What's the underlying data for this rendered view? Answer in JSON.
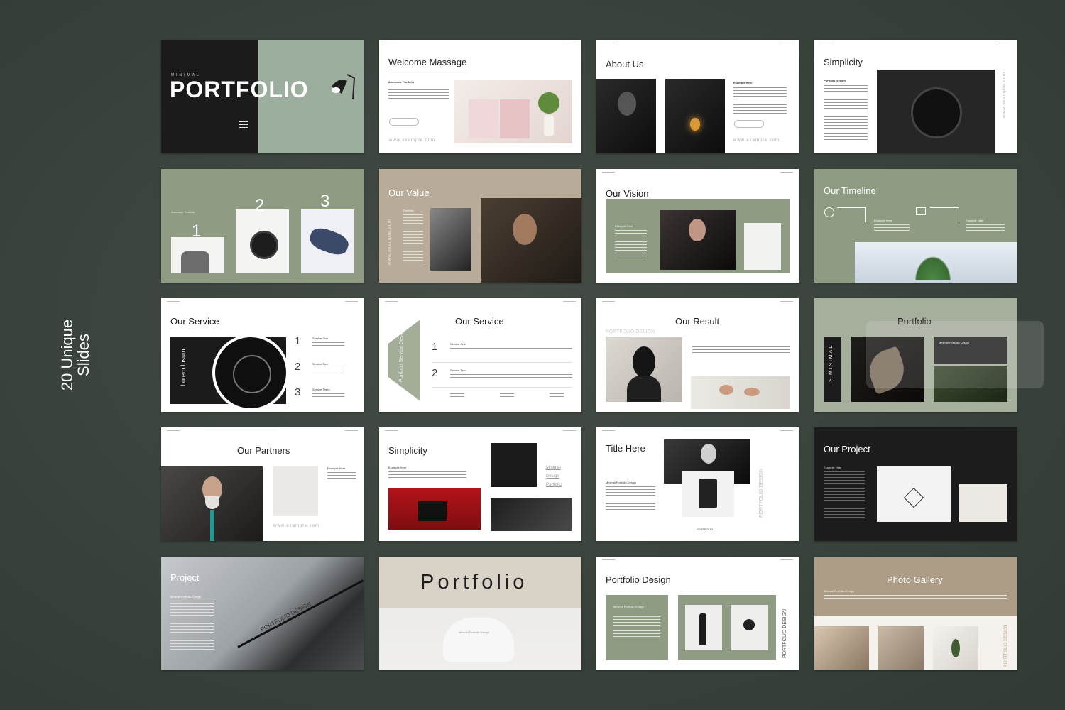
{
  "side_title": {
    "line1": "20 Unique",
    "line2": "Slides"
  },
  "slides": {
    "s1": {
      "small": "MINIMAL",
      "title": "PORTFOLIO"
    },
    "s2": {
      "title": "Welcome Massage",
      "subtitle": "Awesome Portfolio",
      "url": "www.example.com"
    },
    "s3": {
      "title": "About Us",
      "subtitle": "Example Here",
      "url": "www.example.com"
    },
    "s4": {
      "title": "Simplicity",
      "subtitle": "Portfolio Design",
      "url": "www.example.com"
    },
    "s5": {
      "subtitle": "Awesome Portfolio",
      "n1": "1",
      "n2": "2",
      "n3": "3"
    },
    "s6": {
      "title": "Our Value",
      "subtitle": "Portfolio",
      "url": "www.example.com"
    },
    "s7": {
      "title": "Our Vision",
      "subtitle": "Example Here"
    },
    "s8": {
      "title": "Our Timeline",
      "step": "Example Here"
    },
    "s9": {
      "title": "Our Service",
      "vertical": "Lorem Ipsum",
      "n1": "1",
      "n2": "2",
      "n3": "3",
      "svc1": "Service One",
      "svc2": "Service Two",
      "svc3": "Service Three"
    },
    "s10": {
      "title": "Our Service",
      "vertical": "Portfolio Service Design",
      "n1": "1",
      "n2": "2",
      "svc1": "Service One",
      "svc2": "Service Two"
    },
    "s11": {
      "title": "Our Result",
      "subtitle": "PORTFOLIO DESIGN"
    },
    "s12": {
      "title": "Portfolio",
      "vertical": "> MINIMAL",
      "subtitle": "Minimal Portfolio Design"
    },
    "s13": {
      "title": "Our Partners",
      "subtitle": "Example Here",
      "url": "www.example.com"
    },
    "s14": {
      "title": "Simplicity",
      "subtitle": "Example Here",
      "b1": "Minimal",
      "b2": "Design",
      "b3": "Portfolio"
    },
    "s15": {
      "title": "Title Here",
      "subtitle": "Minimal Portfolio Design",
      "vertical": "PORTFOLIO DESIGN",
      "caption": "PORTFOLIO"
    },
    "s16": {
      "title": "Our Project",
      "subtitle": "Example Here"
    },
    "s17": {
      "title": "Project",
      "subtitle": "Minimal Portfolio Design",
      "diagonal": "PORTFOLIO DESIGN"
    },
    "s18": {
      "title": "Portfolio",
      "chair": "Minimal Portfolio Design"
    },
    "s19": {
      "title": "Portfolio Design",
      "card": "Minimal Portfolio Design",
      "vertical": "PORTFOLIO DESIGN"
    },
    "s20": {
      "title": "Photo Gallery",
      "subtitle": "Minimal Portfolio Design",
      "vertical": "PORTFOLIO DESIGN"
    }
  },
  "colors": {
    "background": "#3a423c",
    "sage": "#8f9b82",
    "tan": "#b9ab99",
    "dark": "#1c1c1c"
  }
}
